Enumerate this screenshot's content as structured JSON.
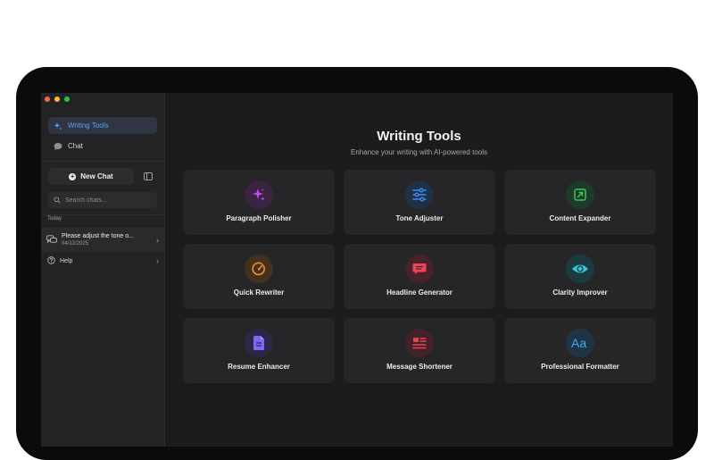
{
  "sidebar": {
    "nav": [
      {
        "label": "Writing Tools",
        "icon": "sparkle-icon",
        "active": true
      },
      {
        "label": "Chat",
        "icon": "chat-bubble-icon",
        "active": false
      }
    ],
    "new_chat_label": "New Chat",
    "search_placeholder": "Search chats...",
    "section_label": "Today",
    "recent_chat": {
      "title": "Please adjust the tone o...",
      "date": "04/12/2025"
    },
    "help_label": "Help"
  },
  "main": {
    "title": "Writing Tools",
    "subtitle": "Enhance your writing with AI-powered tools",
    "tools": [
      {
        "label": "Paragraph Polisher",
        "icon": "sparkles-icon",
        "color": "#c04cf0",
        "bg": "#3b2442"
      },
      {
        "label": "Tone Adjuster",
        "icon": "sliders-icon",
        "color": "#3d8ef5",
        "bg": "#1f3146"
      },
      {
        "label": "Content Expander",
        "icon": "expand-arrow-icon",
        "color": "#34c759",
        "bg": "#1f3a27"
      },
      {
        "label": "Quick Rewriter",
        "icon": "rewrite-gauge-icon",
        "color": "#f0922e",
        "bg": "#43311e"
      },
      {
        "label": "Headline Generator",
        "icon": "headline-message-icon",
        "color": "#f0445a",
        "bg": "#46222a"
      },
      {
        "label": "Clarity Improver",
        "icon": "eye-icon",
        "color": "#35c5dc",
        "bg": "#1c3a40"
      },
      {
        "label": "Resume Enhancer",
        "icon": "document-icon",
        "color": "#7f67f5",
        "bg": "#2b2747"
      },
      {
        "label": "Message Shortener",
        "icon": "message-list-icon",
        "color": "#e8434d",
        "bg": "#44222a"
      },
      {
        "label": "Professional Formatter",
        "icon": "aa-text-icon",
        "color": "#4aa8e8",
        "bg": "#1e3545"
      }
    ]
  },
  "colors": {
    "accent": "#5aa2ff",
    "background": "#1c1c1e",
    "sidebar": "#232325"
  }
}
